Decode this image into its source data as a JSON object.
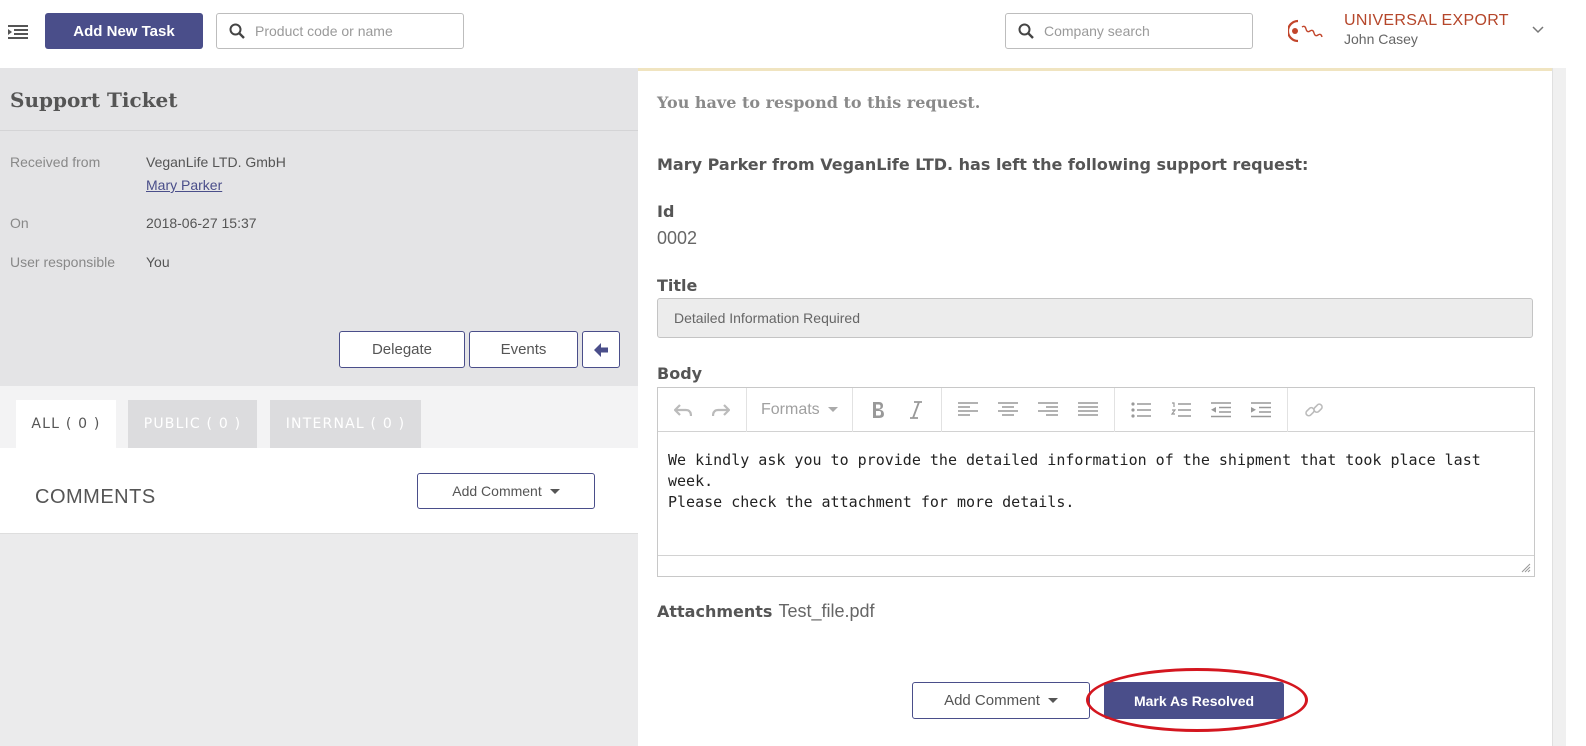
{
  "topbar": {
    "add_task_label": "Add New Task",
    "product_search_placeholder": "Product code or name",
    "company_search_placeholder": "Company search",
    "company_name": "UNIVERSAL EXPORT",
    "user_name": "John Casey",
    "brand_color": "#4a4e8a",
    "company_color": "#b5462a"
  },
  "ticket": {
    "title": "Support Ticket",
    "received_from_label": "Received from",
    "received_from_company": "VeganLife LTD. GmbH",
    "received_from_person": "Mary Parker",
    "on_label": "On",
    "on_value": "2018-06-27 15:37",
    "responsible_label": "User responsible",
    "responsible_value": "You",
    "delegate_label": "Delegate",
    "events_label": "Events"
  },
  "tabs": [
    {
      "label": "ALL ( 0 )",
      "active": true
    },
    {
      "label": "PUBLIC ( 0 )",
      "active": false
    },
    {
      "label": "INTERNAL ( 0 )",
      "active": false
    }
  ],
  "comments": {
    "title": "COMMENTS",
    "add_comment_label": "Add Comment"
  },
  "request": {
    "notice": "You have to respond to this request.",
    "intro": "Mary Parker from VeganLife LTD. has left the following support request:",
    "id_label": "Id",
    "id_value": "0002",
    "title_label": "Title",
    "title_value": "Detailed Information Required",
    "body_label": "Body",
    "formats_label": "Formats",
    "body_line1": "We kindly ask you to provide the detailed information of the shipment that took place last week.",
    "body_line2": "Please check the attachment for more details.",
    "attachments_label": "Attachments",
    "attachment_file": "Test_file.pdf",
    "add_comment_label": "Add Comment",
    "resolve_label": "Mark As Resolved",
    "highlight_color": "#d4161f"
  }
}
